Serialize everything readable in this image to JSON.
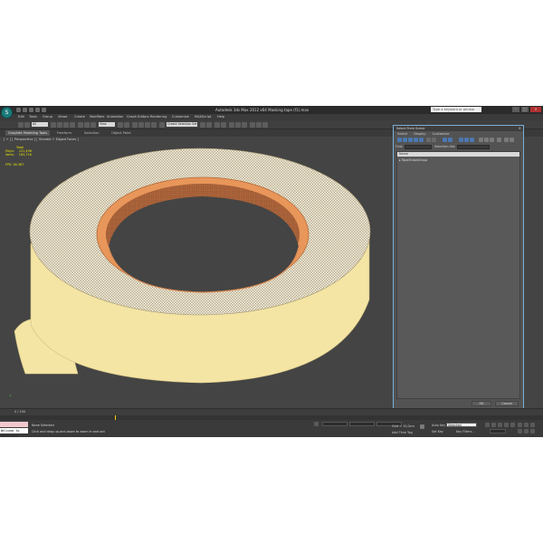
{
  "window": {
    "title": "Autodesk 3ds Max 2012 x64    Masking tape (f1).max",
    "search_placeholder": "Type a keyword or phrase",
    "logo": "3ds-max-logo"
  },
  "menu": [
    "Edit",
    "Tools",
    "Group",
    "Views",
    "Create",
    "Modifiers",
    "Animation",
    "Graph Editors",
    "Rendering",
    "Customize",
    "MAXScript",
    "Help"
  ],
  "toolbar": {
    "selection_filter": "All",
    "view_dropdown": "View",
    "named_selection": "Create Selection Set"
  },
  "ribbon": {
    "tabs": [
      "Graphite Modeling Tools",
      "Freeform",
      "Selection",
      "Object Paint"
    ]
  },
  "viewport": {
    "label": "[ + ] [ Perspective ] [ Shaded + Edged Faces ]",
    "stats": {
      "total_label": "Total",
      "polys_label": "Polys:",
      "polys_value": "121,496",
      "verts_label": "Verts:",
      "verts_value": "163,716"
    },
    "fps_label": "FPS:",
    "fps_value": "36.387"
  },
  "dialog": {
    "title": "Select From Scene",
    "close": "×",
    "menu": [
      "Select",
      "Display",
      "Customize"
    ],
    "find_label": "Find:",
    "selection_set_label": "Selection Set:",
    "column_header": "Name",
    "items": [
      "Tape01dasGroup"
    ],
    "ok": "OK",
    "cancel": "Cancel"
  },
  "timeline": {
    "frame": "0 / 100"
  },
  "status": {
    "selection": "None Selected",
    "prompt": "Click and drag up-and-down to zoom in and out",
    "grid": "Grid = 10,0cm",
    "add_time_tag": "Add Time Tag",
    "auto_key": "Auto Key",
    "set_key": "Set Key",
    "selected": "Selected",
    "key_filters": "Key Filters..."
  },
  "maxscript_text": "Welcome to MAXScript",
  "colors": {
    "tape_body": "#f4e5a4",
    "tape_core": "#e8965a",
    "viewport_bg": "#444444",
    "stats_text": "#e6e600"
  }
}
